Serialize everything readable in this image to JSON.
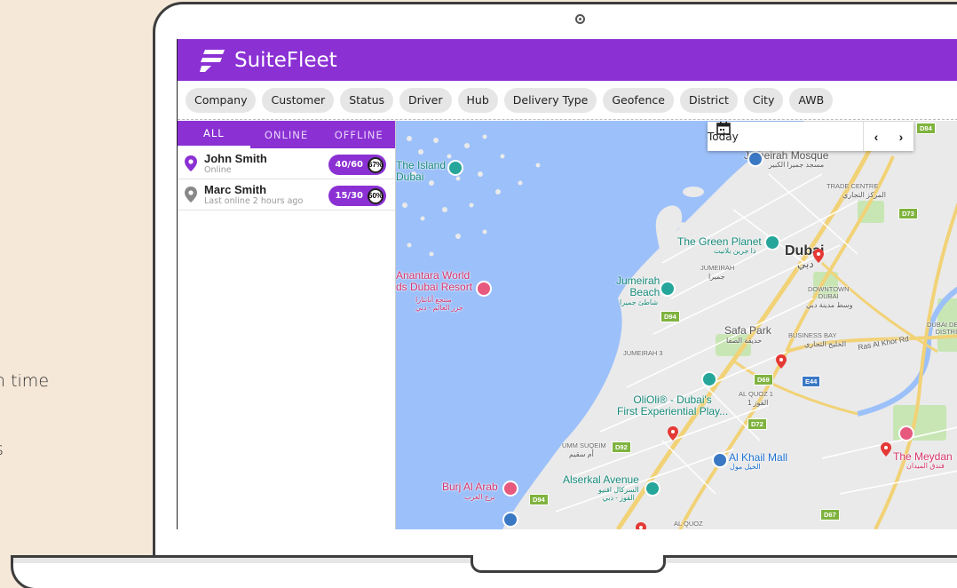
{
  "side_text": [
    "n time",
    "s"
  ],
  "app": {
    "title": "SuiteFleet"
  },
  "filters": [
    "Company",
    "Customer",
    "Status",
    "Driver",
    "Hub",
    "Delivery Type",
    "Geofence",
    "District",
    "City",
    "AWB"
  ],
  "driver_tabs": [
    "ALL",
    "ONLINE",
    "OFFLINE"
  ],
  "drivers": [
    {
      "name": "John Smith",
      "status": "Online",
      "count": "40/60",
      "percent": "67%",
      "pin_color": "#8b31d4"
    },
    {
      "name": "Marc Smith",
      "status": "Last online 2 hours ago",
      "count": "15/30",
      "percent": "50%",
      "pin_color": "#888888"
    }
  ],
  "date_selector": {
    "label": "Today",
    "prev": "‹",
    "next": "›"
  },
  "map": {
    "places": {
      "the_island": "The Island\nDubai",
      "anantara": "Anantara World\nds Dubai Resort",
      "anantara_ar": "منتجع أنانتارا\nجزر العالم - دبي",
      "jumeirah_mosque": "Jumeirah Mosque",
      "jumeirah_mosque_ar": "مسجد جميرا الكبير",
      "trade_centre": "TRADE CENTRE",
      "trade_centre_ar": "المركز التجاري",
      "green_planet": "The Green Planet",
      "green_planet_ar": "ذا جرين بلانيت",
      "dubai": "Dubai",
      "dubai_ar": "دبي",
      "jumeirah": "JUMEIRAH",
      "jumeirah_ar": "جميرا",
      "jumeirah_beach": "Jumeirah\nBeach",
      "jumeirah_beach_ar": "شاطئ جميرا",
      "downtown": "DOWNTOWN\nDUBAI",
      "downtown_ar": "وسط مدينة دبي",
      "business_bay": "BUSINESS BAY",
      "business_bay_ar": "الخليج التجاري",
      "design_district": "DUBAI DESIGN\nDISTRICT",
      "ras_al_khor": "Ras Al Khor Rd",
      "safa_park": "Safa Park",
      "safa_park_ar": "حديقة الصفا",
      "jumeirah_3": "JUMEIRAH 3",
      "al_quoz_1": "AL QUOZ 1",
      "al_quoz_1_ar": "القوز 1",
      "olioli": "OliOli® - Dubai's\nFirst Experiential Play...",
      "umm_suqeim": "UMM SUQEIM",
      "umm_suqeim_ar": "أم سقيم",
      "al_khail": "Al Khail Mall",
      "al_khail_ar": "الخيل مول",
      "meydan": "The Meydan",
      "meydan_ar": "فندق الميدان",
      "alserkal": "Alserkal Avenue",
      "alserkal_ar": "السركال افنيو\nالقوز - دبي",
      "burj_al_arab": "Burj Al Arab",
      "burj_al_arab_ar": "برج العرب",
      "al_quoz": "AL QUOZ"
    },
    "roads": [
      "D84",
      "D73",
      "D94",
      "D69",
      "E44",
      "D72",
      "D92",
      "D94",
      "D67"
    ]
  }
}
